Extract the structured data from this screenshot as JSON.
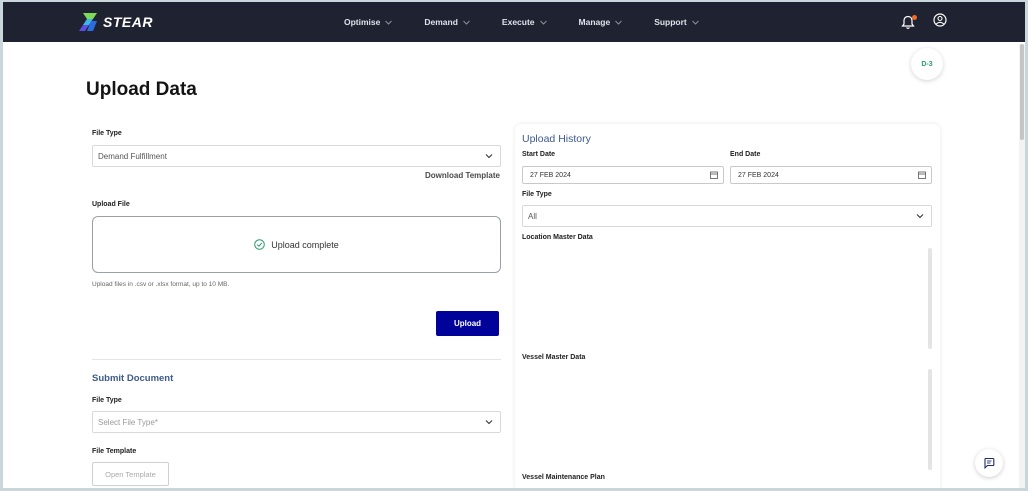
{
  "brand": {
    "name": "STEAR"
  },
  "nav": {
    "items": [
      {
        "label": "Optimise"
      },
      {
        "label": "Demand"
      },
      {
        "label": "Execute"
      },
      {
        "label": "Manage"
      },
      {
        "label": "Support"
      }
    ]
  },
  "badge": {
    "label": "D-3"
  },
  "page": {
    "title": "Upload Data"
  },
  "upload_form": {
    "file_type_label": "File Type",
    "file_type_value": "Demand Fulfillment",
    "download_template": "Download Template",
    "upload_file_label": "Upload File",
    "upload_status": "Upload complete",
    "hint": "Upload files in .csv or .xlsx format, up to 10 MB.",
    "upload_button": "Upload"
  },
  "submit_document": {
    "title": "Submit Document",
    "file_type_label": "File Type",
    "file_type_placeholder": "Select File Type*",
    "file_template_label": "File Template",
    "open_template_button": "Open Template"
  },
  "upload_history": {
    "title": "Upload History",
    "start_date_label": "Start Date",
    "start_date_value": "27 FEB 2024",
    "end_date_label": "End Date",
    "end_date_value": "27 FEB 2024",
    "file_type_label": "File Type",
    "file_type_value": "All",
    "sections": [
      {
        "title": "Location Master Data"
      },
      {
        "title": "Vessel Master Data"
      },
      {
        "title": "Vessel Maintenance Plan"
      }
    ]
  },
  "colors": {
    "navbar": "#1f2230",
    "primary_button": "#00029a",
    "accent_text": "#3c5a8a",
    "success": "#2a9d6a",
    "notification_dot": "#f26b2d"
  },
  "icons": {
    "logo": "stear-logo-icon",
    "bell": "bell-icon",
    "user": "user-circle-icon",
    "check": "check-circle-icon",
    "calendar": "calendar-icon",
    "chevron": "chevron-down-icon",
    "chat": "chat-icon"
  }
}
